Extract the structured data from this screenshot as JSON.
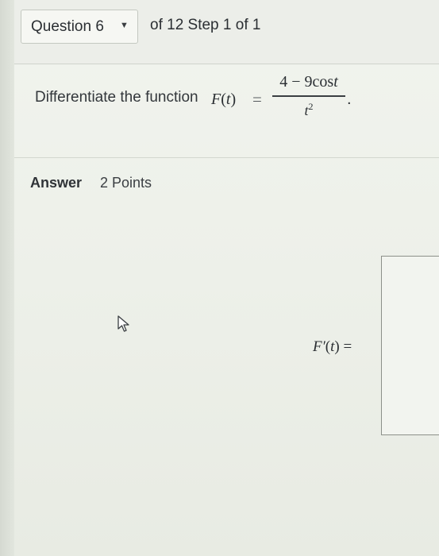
{
  "header": {
    "question_selector": "Question 6",
    "step_info": "of 12 Step 1 of 1"
  },
  "question": {
    "prompt": "Differentiate the function",
    "function_name": "F",
    "variable": "t",
    "numerator": "4 − 9cos",
    "numerator_var": "t",
    "denominator_var": "t",
    "denominator_exp": "2"
  },
  "answer": {
    "heading": "Answer",
    "points": "2 Points",
    "derivative_name": "F′",
    "derivative_var": "t",
    "equals": "="
  },
  "icons": {
    "dropdown": "chevron-down-icon",
    "cursor": "mouse-pointer-icon"
  }
}
